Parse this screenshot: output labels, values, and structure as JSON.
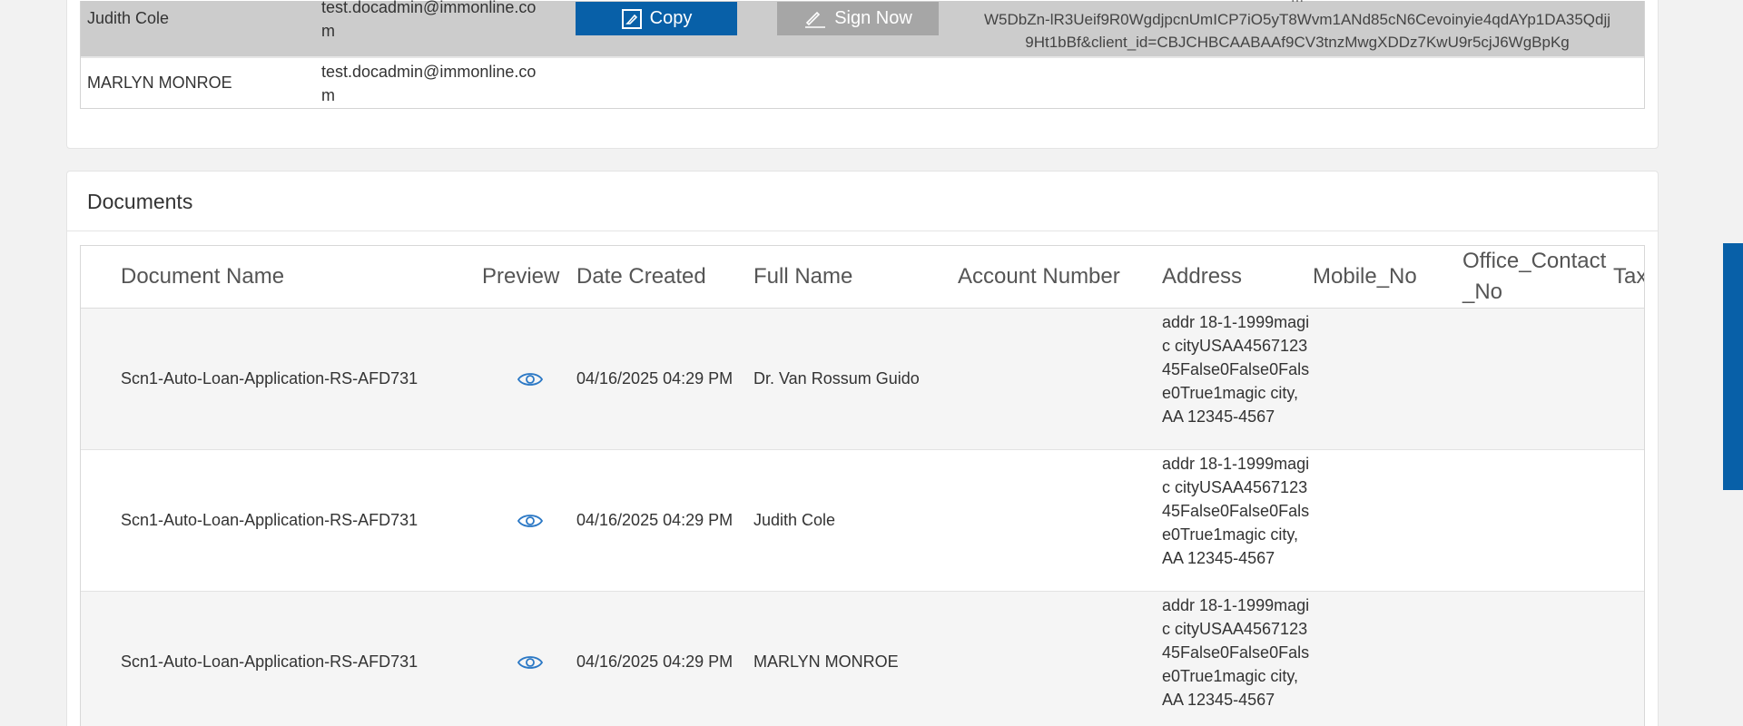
{
  "signers": {
    "rows": [
      {
        "name": "Judith Cole",
        "email": "test.docadmin@immonline.com",
        "copy_label": "Copy",
        "sign_label": "Sign Now",
        "url_lines": [
          "...",
          "W5DbZn-lR3Ueif9R0WgdjpcnUmICP7iO5yT8Wvm1ANd85cN6Cevoinyie4qdAYp1DA35Qdjj",
          "9Ht1bBf&client_id=CBJCHBCAABAAf9CV3tnzMwgXDDz7KwU9r5cjJ6WgBpKg"
        ]
      },
      {
        "name": "MARLYN MONROE",
        "email": "test.docadmin@immonline.com"
      }
    ]
  },
  "documents": {
    "title": "Documents",
    "columns": [
      "Document Name",
      "Preview",
      "Date Created",
      "Full Name",
      "Account Number",
      "Address",
      "Mobile_No",
      "Office_Contact_No",
      "Tax"
    ],
    "rows": [
      {
        "document_name": "Scn1-Auto-Loan-Application-RS-AFD731",
        "date_created": "04/16/2025 04:29 PM",
        "full_name": "Dr. Van Rossum Guido",
        "account_number": "",
        "address": "addr 18-1-1999magic cityUSAA456712345False0False0False0True1magic city, AA 12345-4567",
        "mobile_no": "",
        "office_contact_no": ""
      },
      {
        "document_name": "Scn1-Auto-Loan-Application-RS-AFD731",
        "date_created": "04/16/2025 04:29 PM",
        "full_name": "Judith Cole",
        "account_number": "",
        "address": "addr 18-1-1999magic cityUSAA456712345False0False0False0True1magic city, AA 12345-4567",
        "mobile_no": "",
        "office_contact_no": ""
      },
      {
        "document_name": "Scn1-Auto-Loan-Application-RS-AFD731",
        "date_created": "04/16/2025 04:29 PM",
        "full_name": "MARLYN MONROE",
        "account_number": "",
        "address": "addr 18-1-1999magic cityUSAA456712345False0False0False0True1magic city, AA 12345-4567",
        "mobile_no": "",
        "office_contact_no": ""
      }
    ]
  },
  "icons": {
    "preview": "eye-icon",
    "copy": "copy-icon",
    "sign": "pen-icon"
  },
  "colors": {
    "primary": "#0860a8",
    "disabled_button": "#a6a6a6",
    "highlight_row": "#cccccc",
    "preview_icon": "#2b78c5"
  }
}
